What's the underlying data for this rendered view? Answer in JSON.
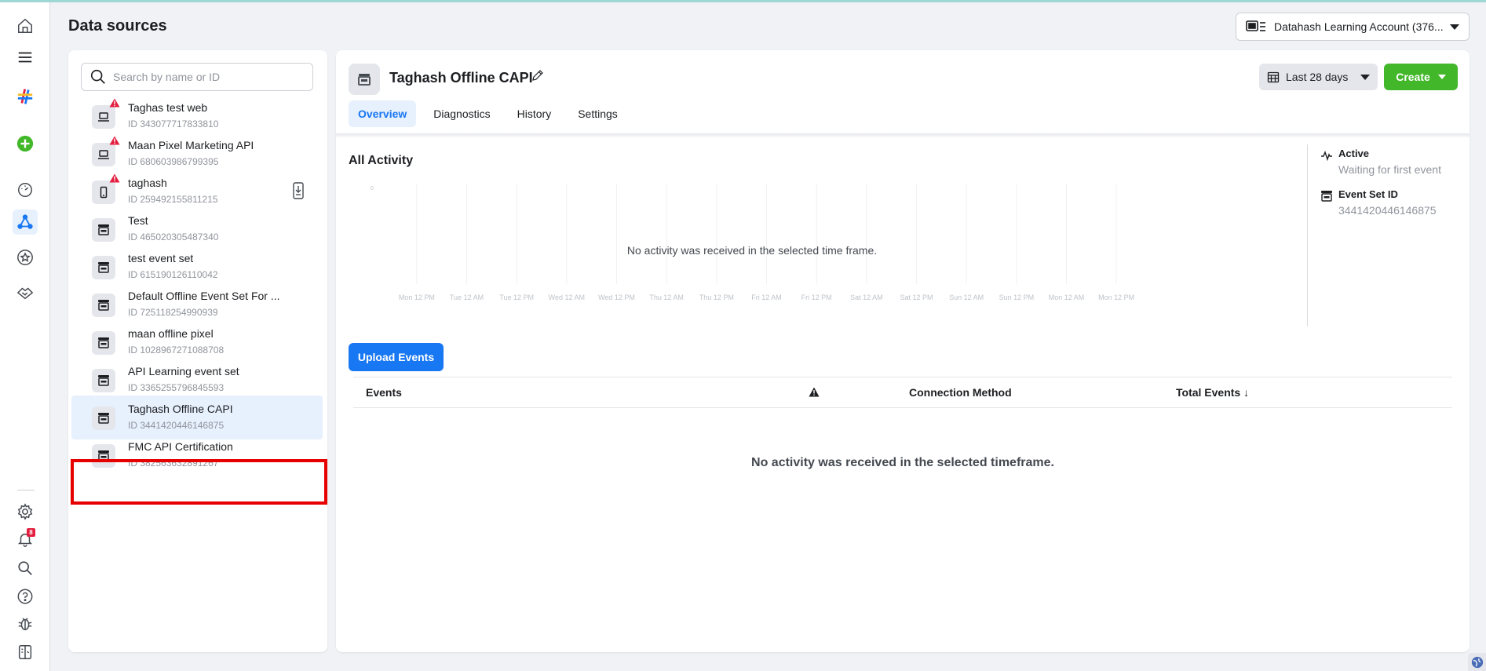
{
  "header": {
    "title": "Data sources",
    "account_label": "Datahash Learning Account (376..."
  },
  "rail": {
    "notification_count": "8"
  },
  "search": {
    "placeholder": "Search by name or ID"
  },
  "data_sources": [
    {
      "name": "Taghas test web",
      "id": "ID 343077717833810",
      "icon": "laptop-icon",
      "warning": true
    },
    {
      "name": "Maan Pixel Marketing API",
      "id": "ID 680603986799395",
      "icon": "laptop-icon",
      "warning": true
    },
    {
      "name": "taghash",
      "id": "ID 259492155811215",
      "icon": "mobile-icon",
      "warning": true
    },
    {
      "name": "Test",
      "id": "ID 465020305487340",
      "icon": "store-icon",
      "warning": false
    },
    {
      "name": "test event set",
      "id": "ID 615190126110042",
      "icon": "store-icon",
      "warning": false
    },
    {
      "name": "Default Offline Event Set For ...",
      "id": "ID 725118254990939",
      "icon": "store-icon",
      "warning": false
    },
    {
      "name": "maan offline pixel",
      "id": "ID 1028967271088708",
      "icon": "store-icon",
      "warning": false
    },
    {
      "name": "API Learning event set",
      "id": "ID 3365255796845593",
      "icon": "store-icon",
      "warning": false
    },
    {
      "name": "Taghash Offline CAPI",
      "id": "ID 3441420446146875",
      "icon": "store-icon",
      "warning": false,
      "selected": true
    },
    {
      "name": "FMC API Certification",
      "id": "ID 382563632891267",
      "icon": "store-icon",
      "warning": false
    }
  ],
  "detail": {
    "title": "Taghash Offline CAPI",
    "tabs": [
      "Overview",
      "Diagnostics",
      "History",
      "Settings"
    ],
    "active_tab": "Overview",
    "date_range": "Last 28 days",
    "create_label": "Create",
    "activity_title": "All Activity",
    "chart_empty": "No activity was received in the selected time frame.",
    "status_label": "Active",
    "status_sub": "Waiting for first event",
    "event_set_label": "Event Set ID",
    "event_set_id": "3441420446146875",
    "upload_label": "Upload Events",
    "table": {
      "columns": [
        "Events",
        "Connection Method",
        "Total Events ↓"
      ],
      "empty": "No activity was received in the selected timeframe."
    }
  },
  "chart_data": {
    "type": "line",
    "x": [
      "Mon 12 PM",
      "Tue 12 AM",
      "Tue 12 PM",
      "Wed 12 AM",
      "Wed 12 PM",
      "Thu 12 AM",
      "Thu 12 PM",
      "Fri 12 AM",
      "Fri 12 PM",
      "Sat 12 AM",
      "Sat 12 PM",
      "Sun 12 AM",
      "Sun 12 PM",
      "Mon 12 AM",
      "Mon 12 PM"
    ],
    "series": [],
    "grid": true,
    "ylabel_tick": "0"
  },
  "colors": {
    "primary": "#1877f2",
    "create": "#42b72a",
    "warning": "#e41e3f",
    "highlight": "#e60000"
  }
}
